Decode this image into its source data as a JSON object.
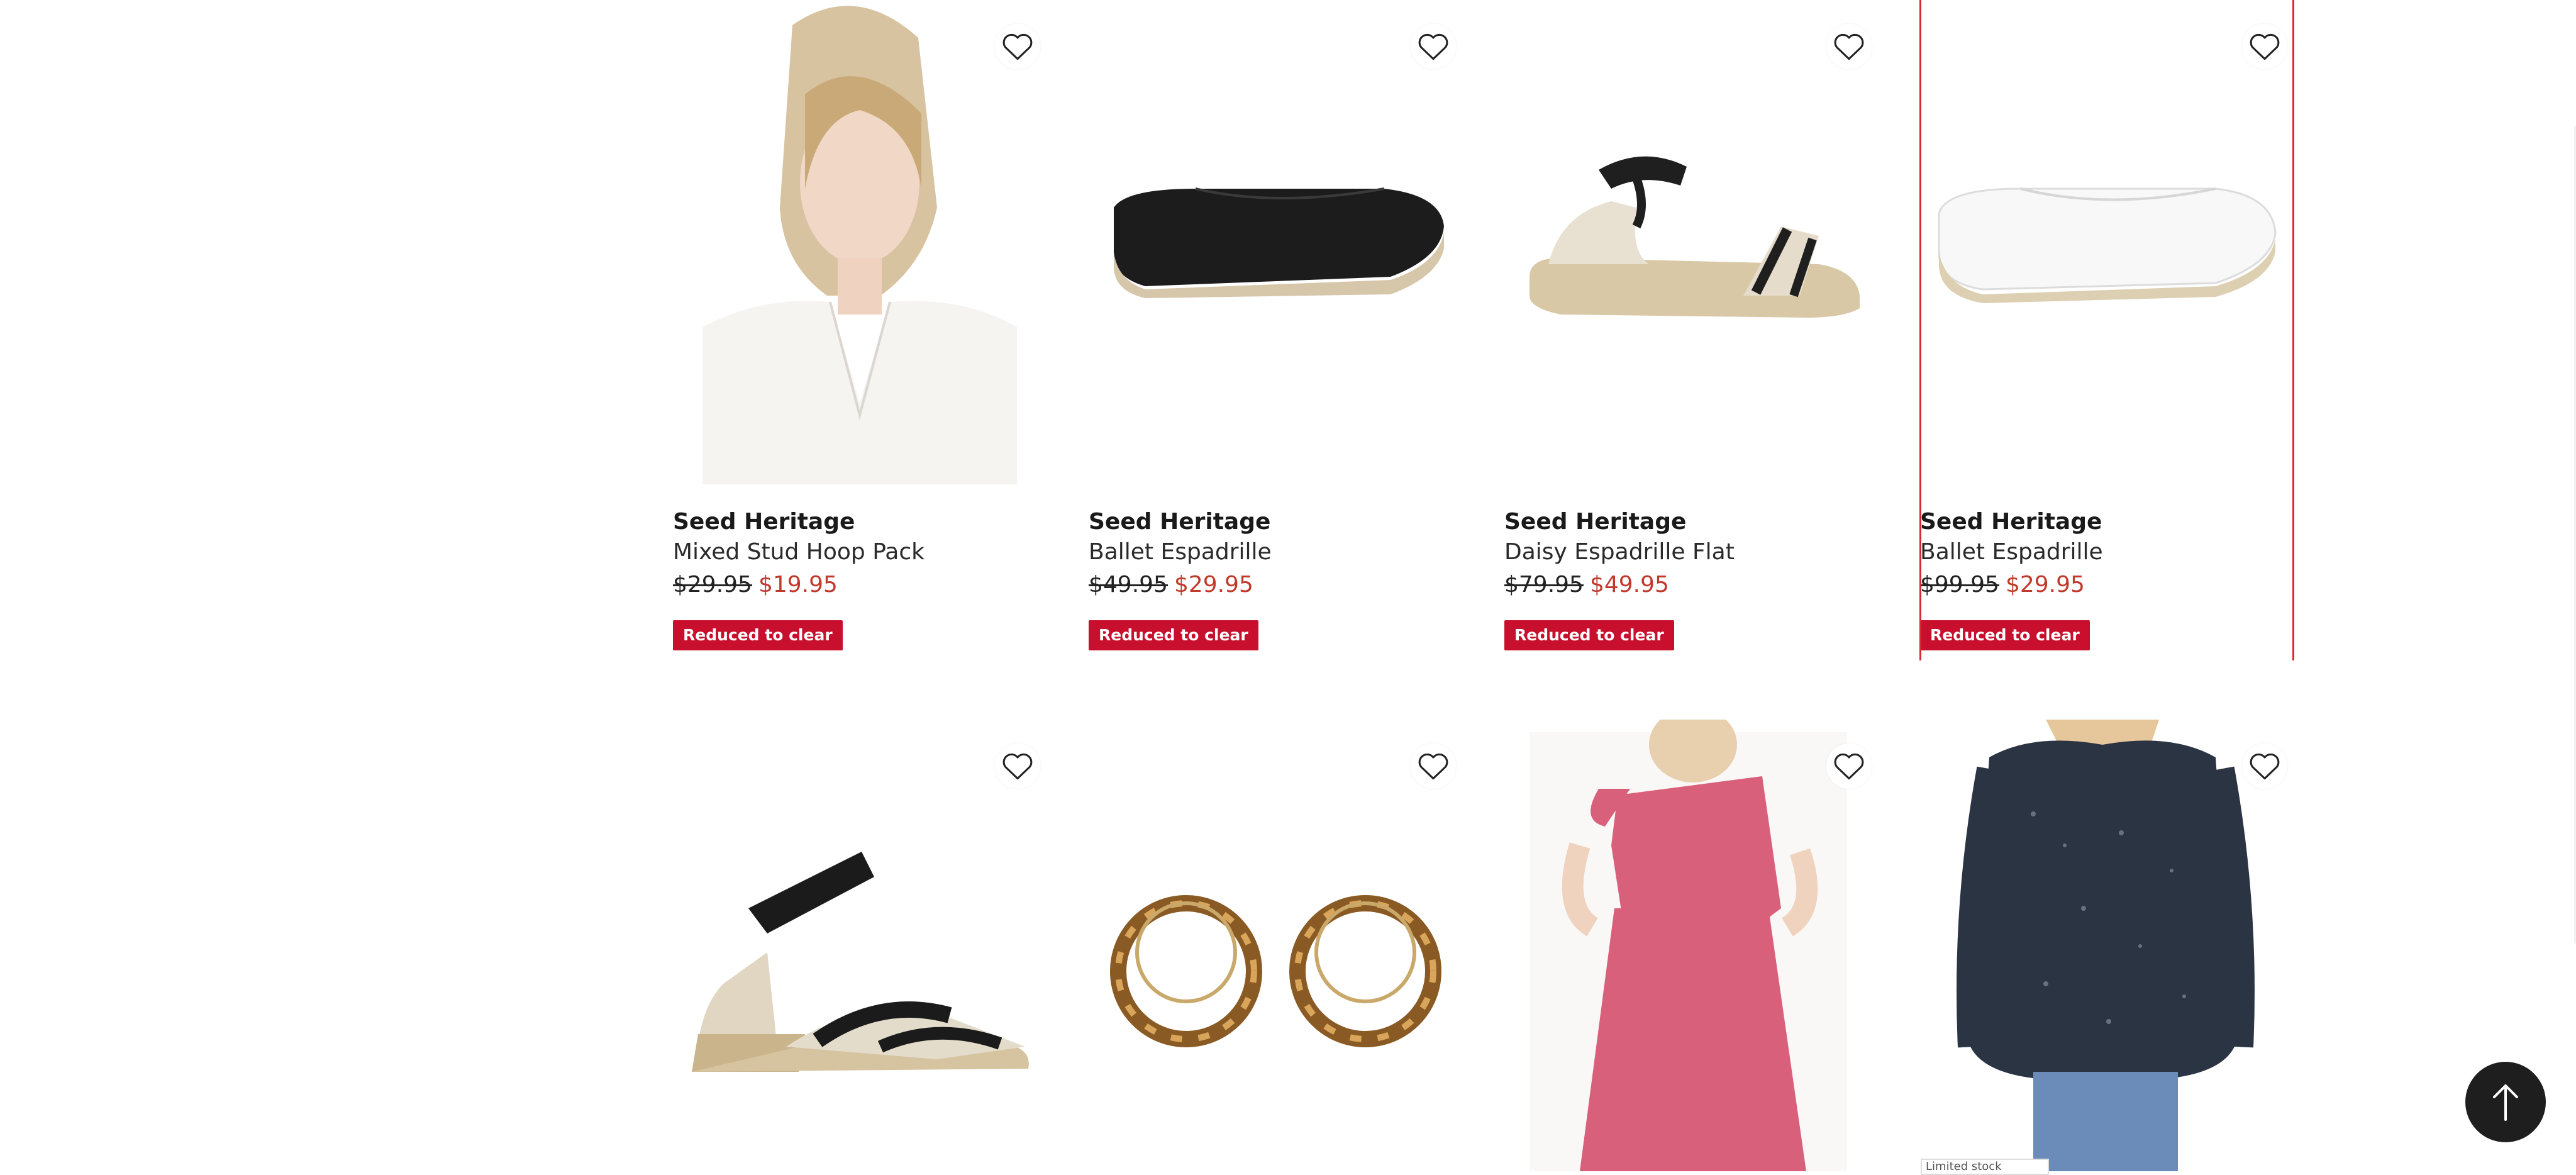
{
  "colors": {
    "sale_price": "#c0392b",
    "badge_bg": "#c8102e",
    "selection_border": "#d9282f",
    "back_to_top_bg": "#1e1e1e"
  },
  "products": [
    {
      "brand": "Seed Heritage",
      "name": "Mixed Stud Hoop Pack",
      "old_price": "$29.95",
      "price": "$19.95",
      "badge": "Reduced to clear",
      "image": "model-woman-white-blouse"
    },
    {
      "brand": "Seed Heritage",
      "name": "Ballet Espadrille",
      "old_price": "$49.95",
      "price": "$29.95",
      "badge": "Reduced to clear",
      "image": "black-espadrille-flat"
    },
    {
      "brand": "Seed Heritage",
      "name": "Daisy Espadrille Flat",
      "old_price": "$79.95",
      "price": "$49.95",
      "badge": "Reduced to clear",
      "image": "canvas-strap-espadrille-sandal"
    },
    {
      "brand": "Seed Heritage",
      "name": "Ballet Espadrille",
      "old_price": "$99.95",
      "price": "$29.95",
      "badge": "Reduced to clear",
      "image": "white-espadrille-flat"
    }
  ],
  "row2": [
    {
      "image": "espadrille-wedge-sandal"
    },
    {
      "image": "tortoiseshell-hoop-earrings"
    },
    {
      "image": "pink-one-shoulder-dress"
    },
    {
      "image": "printed-navy-blouse",
      "overlay_label": "Limited stock"
    }
  ],
  "icons": {
    "wishlist": "heart-outline-icon",
    "back_to_top": "arrow-up-icon"
  }
}
